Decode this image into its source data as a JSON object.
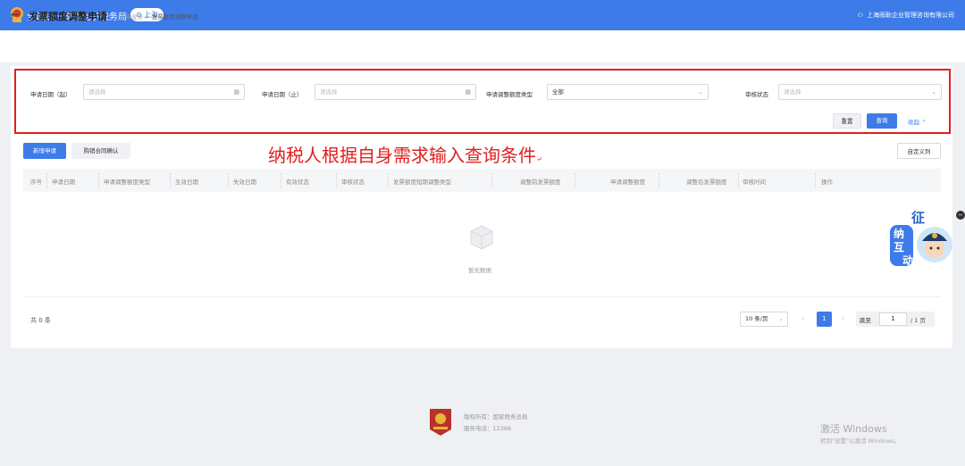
{
  "header": {
    "site_title": "全国统一规范电子税务局",
    "region": "上海",
    "user": "上海雨耿企业管理咨询有限公司"
  },
  "page": {
    "back_icon": "arrow-left-icon",
    "title": "发票额度调整申请",
    "breadcrumb": [
      "发票业务",
      "发票额度调整申请"
    ]
  },
  "filters": {
    "start_date": {
      "label": "申请日期（起）",
      "placeholder": "请选择"
    },
    "end_date": {
      "label": "申请日期（止）",
      "placeholder": "请选择"
    },
    "adjust_type": {
      "label": "申请调整额度类型",
      "value": "全部"
    },
    "review_status": {
      "label": "审核状态",
      "placeholder": "请选择"
    },
    "reset_label": "重置",
    "query_label": "查询",
    "collapse_label": "收起"
  },
  "annotation": "纳税人根据自身需求输入查询条件",
  "toolbar": {
    "new_label": "新增申请",
    "confirm_label": "购销合同确认",
    "columns_label": "自定义列"
  },
  "table": {
    "columns": [
      "序号",
      "申请日期",
      "申请调整额度类型",
      "生效日期",
      "失效日期",
      "有效状态",
      "审核状态",
      "发票额度短期调整类型",
      "调整前发票额度",
      "申请调整额度",
      "调整后发票额度",
      "审核时间",
      "操作"
    ],
    "empty_text": "暂无数据"
  },
  "pagination": {
    "total": "共 0 条",
    "page_size": "10 条/页",
    "current_page": "1",
    "jump_label": "跳至",
    "jump_value": "1",
    "total_pages": "/ 1 页"
  },
  "assistant": {
    "chars": [
      "征",
      "纳",
      "互",
      "动"
    ]
  },
  "footer": {
    "copyright": "版权所有：国家税务总局",
    "phone": "服务电话：12366"
  },
  "watermark": {
    "line1": "激活 Windows",
    "line2": "转到\"设置\"以激活 Windows。"
  },
  "colors": {
    "primary": "#3d7be8",
    "annotation_red": "#e02020"
  }
}
